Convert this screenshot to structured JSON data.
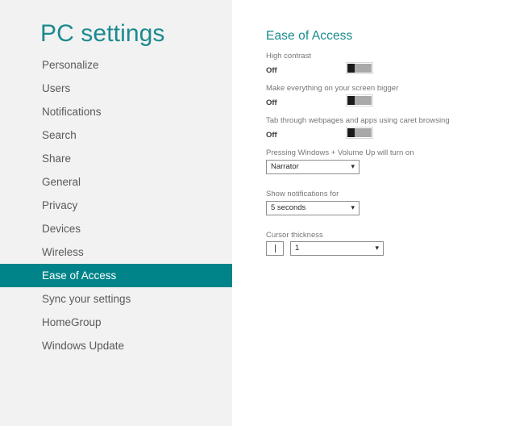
{
  "sidebar": {
    "title": "PC settings",
    "items": [
      {
        "label": "Personalize",
        "selected": false
      },
      {
        "label": "Users",
        "selected": false
      },
      {
        "label": "Notifications",
        "selected": false
      },
      {
        "label": "Search",
        "selected": false
      },
      {
        "label": "Share",
        "selected": false
      },
      {
        "label": "General",
        "selected": false
      },
      {
        "label": "Privacy",
        "selected": false
      },
      {
        "label": "Devices",
        "selected": false
      },
      {
        "label": "Wireless",
        "selected": false
      },
      {
        "label": "Ease of Access",
        "selected": true
      },
      {
        "label": "Sync your settings",
        "selected": false
      },
      {
        "label": "HomeGroup",
        "selected": false
      },
      {
        "label": "Windows Update",
        "selected": false
      }
    ]
  },
  "content": {
    "heading": "Ease of Access",
    "settings": {
      "high_contrast": {
        "label": "High contrast",
        "state": "Off"
      },
      "make_bigger": {
        "label": "Make everything on your screen bigger",
        "state": "Off"
      },
      "caret_browsing": {
        "label": "Tab through webpages and apps using caret browsing",
        "state": "Off"
      },
      "volume_up_shortcut": {
        "label": "Pressing Windows + Volume Up will turn on",
        "value": "Narrator",
        "arrow": "chevron-down"
      },
      "notifications_duration": {
        "label": "Show notifications for",
        "value": "5 seconds",
        "arrow": "chevron-down"
      },
      "cursor_thickness": {
        "label": "Cursor thickness",
        "value": "1",
        "arrow": "chevron-down",
        "preview": "caret"
      }
    }
  },
  "colors": {
    "accent_teal": "#008489",
    "title_teal": "#1b8a8f",
    "sidebar_bg": "#f2f2f2",
    "content_bg": "#ffffff",
    "label_gray": "#767676",
    "nav_gray": "#5a5a5a"
  }
}
